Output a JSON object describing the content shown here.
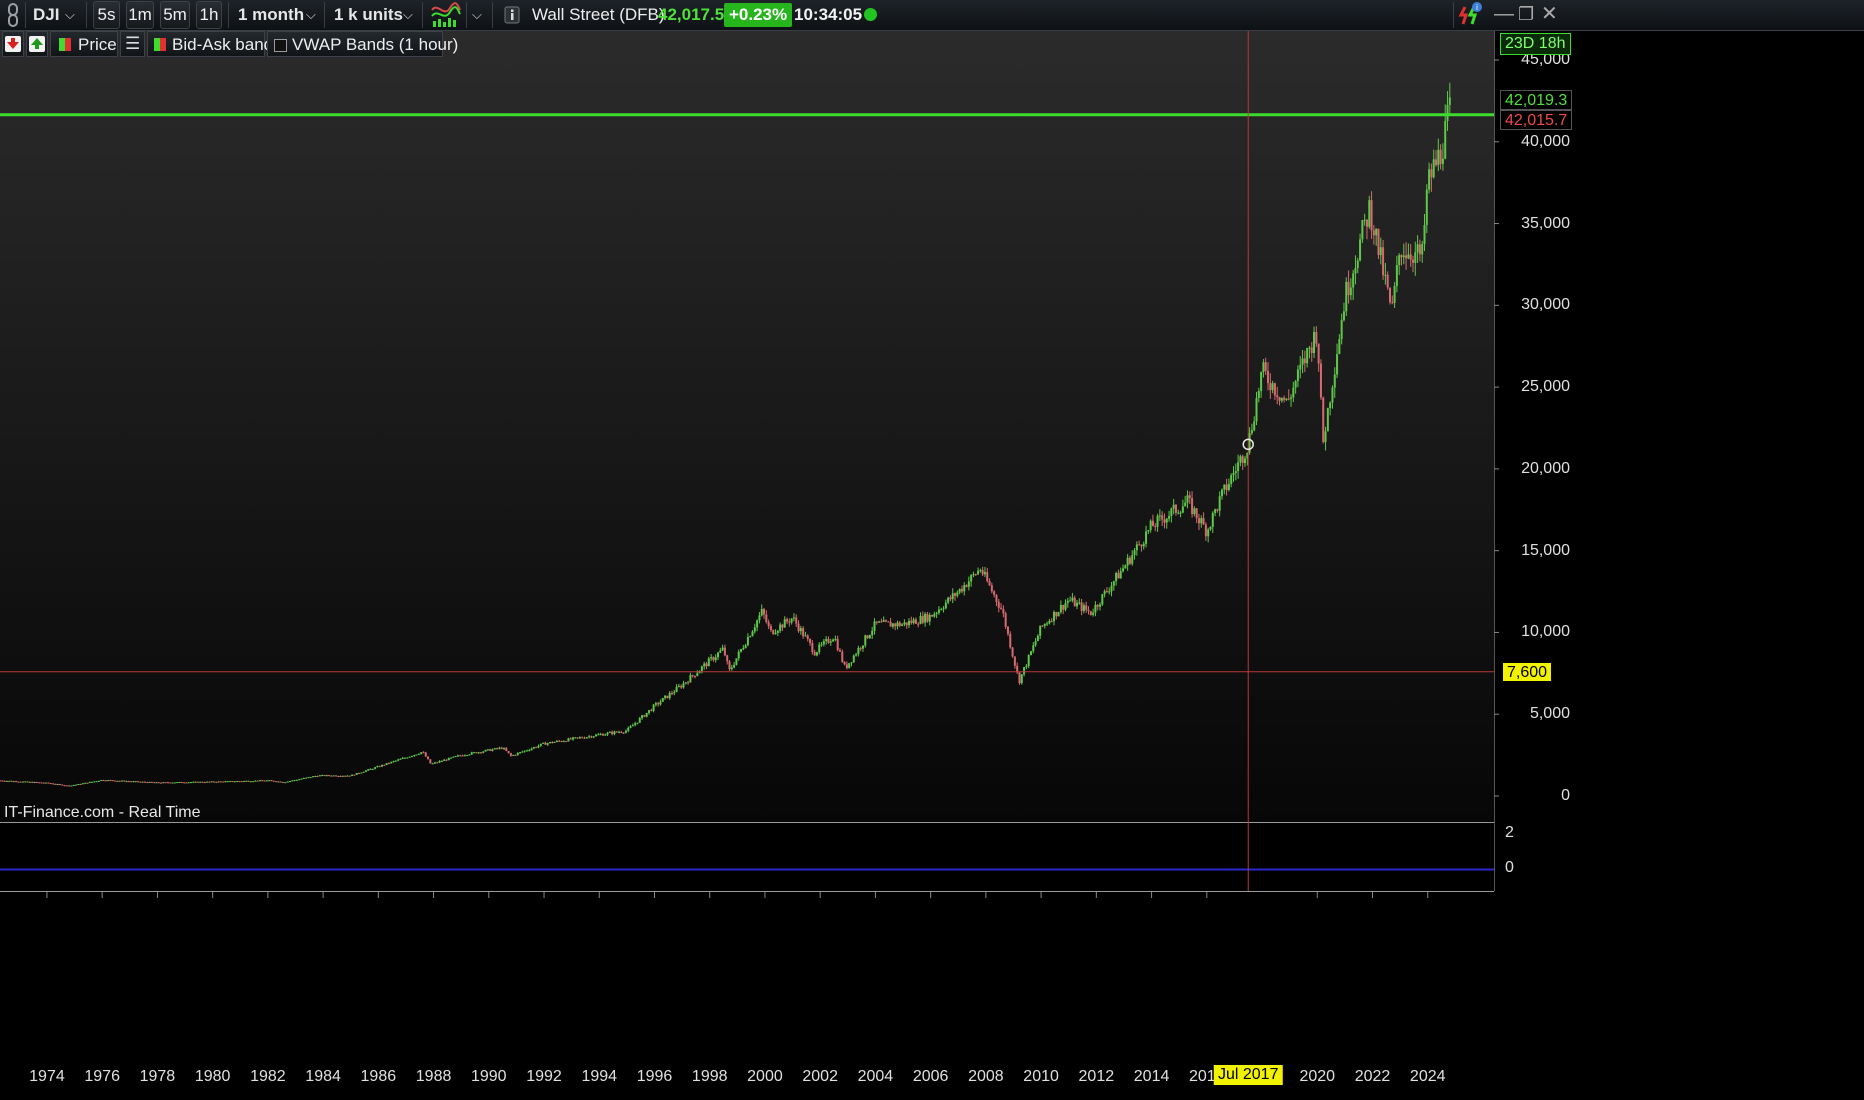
{
  "toolbar": {
    "symbol": "DJI",
    "timeframes": [
      "5s",
      "1m",
      "5m",
      "1h"
    ],
    "period": "1 month",
    "units": "1 k units",
    "instrument": "Wall Street (DFB)",
    "price": "42,017.5",
    "change": "+0.23%",
    "time": "10:34:05",
    "status_color": "#22c422",
    "icons": [
      "chain-link-icon",
      "indicator-wave-icon",
      "info-icon",
      "alert-icon",
      "minimize-icon",
      "restore-icon",
      "close-icon"
    ]
  },
  "indicators": {
    "price_label": "Price",
    "bidask_label": "Bid-Ask band",
    "vwap_label": "VWAP Bands (1 hour)",
    "icons": [
      "sell-arrow-icon",
      "buy-arrow-icon",
      "price-swatch-icon",
      "list-icon",
      "bidask-swatch-icon",
      "checkbox-icon"
    ]
  },
  "overlay": {
    "countdown": "23D 18h",
    "ask_label": "42,019.3",
    "bid_label": "42,015.7",
    "crosshair_price": "7,600",
    "crosshair_date": "Jul 2017",
    "watermark": "IT-Finance.com - Real Time"
  },
  "colors": {
    "up": "#5ec84a",
    "down": "#d86a6f",
    "price_line": "#3ddc2e",
    "crosshair": "#b83a3a",
    "lower_line": "#2a2ad0",
    "tag_yellow": "#f2f200"
  },
  "chart_data": {
    "type": "candlestick",
    "title": "",
    "xlabel": "",
    "ylabel": "",
    "ylim": [
      0,
      45000
    ],
    "yticks": [
      "45,000",
      "40,000",
      "35,000",
      "30,000",
      "25,000",
      "20,000",
      "15,000",
      "10,000",
      "5,000",
      "0"
    ],
    "ytick_values": [
      45000,
      40000,
      35000,
      30000,
      25000,
      20000,
      15000,
      10000,
      5000,
      0
    ],
    "xticks": [
      "1974",
      "1976",
      "1978",
      "1980",
      "1982",
      "1984",
      "1986",
      "1988",
      "1990",
      "1992",
      "1994",
      "1996",
      "1998",
      "2000",
      "2002",
      "2004",
      "2006",
      "2008",
      "2010",
      "2012",
      "2014",
      "2016",
      "2020",
      "2022",
      "2024"
    ],
    "x_range": [
      1972.3,
      2026.4
    ],
    "grid": false,
    "horizontal_line": 41650,
    "crosshair": {
      "x": 2017.5,
      "y": 7600
    },
    "monthly_close_anchors": [
      [
        1972.3,
        950
      ],
      [
        1974.0,
        800
      ],
      [
        1974.8,
        620
      ],
      [
        1976.0,
        980
      ],
      [
        1978.0,
        820
      ],
      [
        1980.0,
        870
      ],
      [
        1982.0,
        950
      ],
      [
        1982.6,
        850
      ],
      [
        1983.8,
        1250
      ],
      [
        1985.0,
        1250
      ],
      [
        1986.0,
        1800
      ],
      [
        1987.6,
        2700
      ],
      [
        1987.9,
        1950
      ],
      [
        1989.0,
        2500
      ],
      [
        1990.5,
        2950
      ],
      [
        1990.8,
        2450
      ],
      [
        1992.0,
        3200
      ],
      [
        1994.0,
        3750
      ],
      [
        1995.0,
        4000
      ],
      [
        1996.0,
        5500
      ],
      [
        1997.0,
        6800
      ],
      [
        1998.5,
        9000
      ],
      [
        1998.7,
        7600
      ],
      [
        1999.9,
        11300
      ],
      [
        2000.2,
        10000
      ],
      [
        2001.0,
        10900
      ],
      [
        2001.8,
        8800
      ],
      [
        2002.5,
        9800
      ],
      [
        2002.9,
        7800
      ],
      [
        2004.0,
        10500
      ],
      [
        2005.0,
        10500
      ],
      [
        2006.0,
        11000
      ],
      [
        2007.0,
        12500
      ],
      [
        2007.8,
        13900
      ],
      [
        2008.6,
        11300
      ],
      [
        2009.2,
        7000
      ],
      [
        2010.0,
        10300
      ],
      [
        2011.0,
        12000
      ],
      [
        2011.8,
        11200
      ],
      [
        2013.0,
        14000
      ],
      [
        2014.0,
        16500
      ],
      [
        2015.3,
        18000
      ],
      [
        2016.0,
        16200
      ],
      [
        2016.5,
        18200
      ],
      [
        2017.5,
        21500
      ],
      [
        2018.0,
        26000
      ],
      [
        2018.9,
        24000
      ],
      [
        2019.5,
        26500
      ],
      [
        2020.0,
        28500
      ],
      [
        2020.2,
        21500
      ],
      [
        2021.0,
        30500
      ],
      [
        2021.9,
        36000
      ],
      [
        2022.7,
        29500
      ],
      [
        2023.0,
        33500
      ],
      [
        2023.8,
        33000
      ],
      [
        2024.0,
        37500
      ],
      [
        2024.5,
        39500
      ],
      [
        2024.8,
        42000
      ]
    ]
  },
  "lower_panel": {
    "yticks": [
      "2",
      "0"
    ]
  }
}
